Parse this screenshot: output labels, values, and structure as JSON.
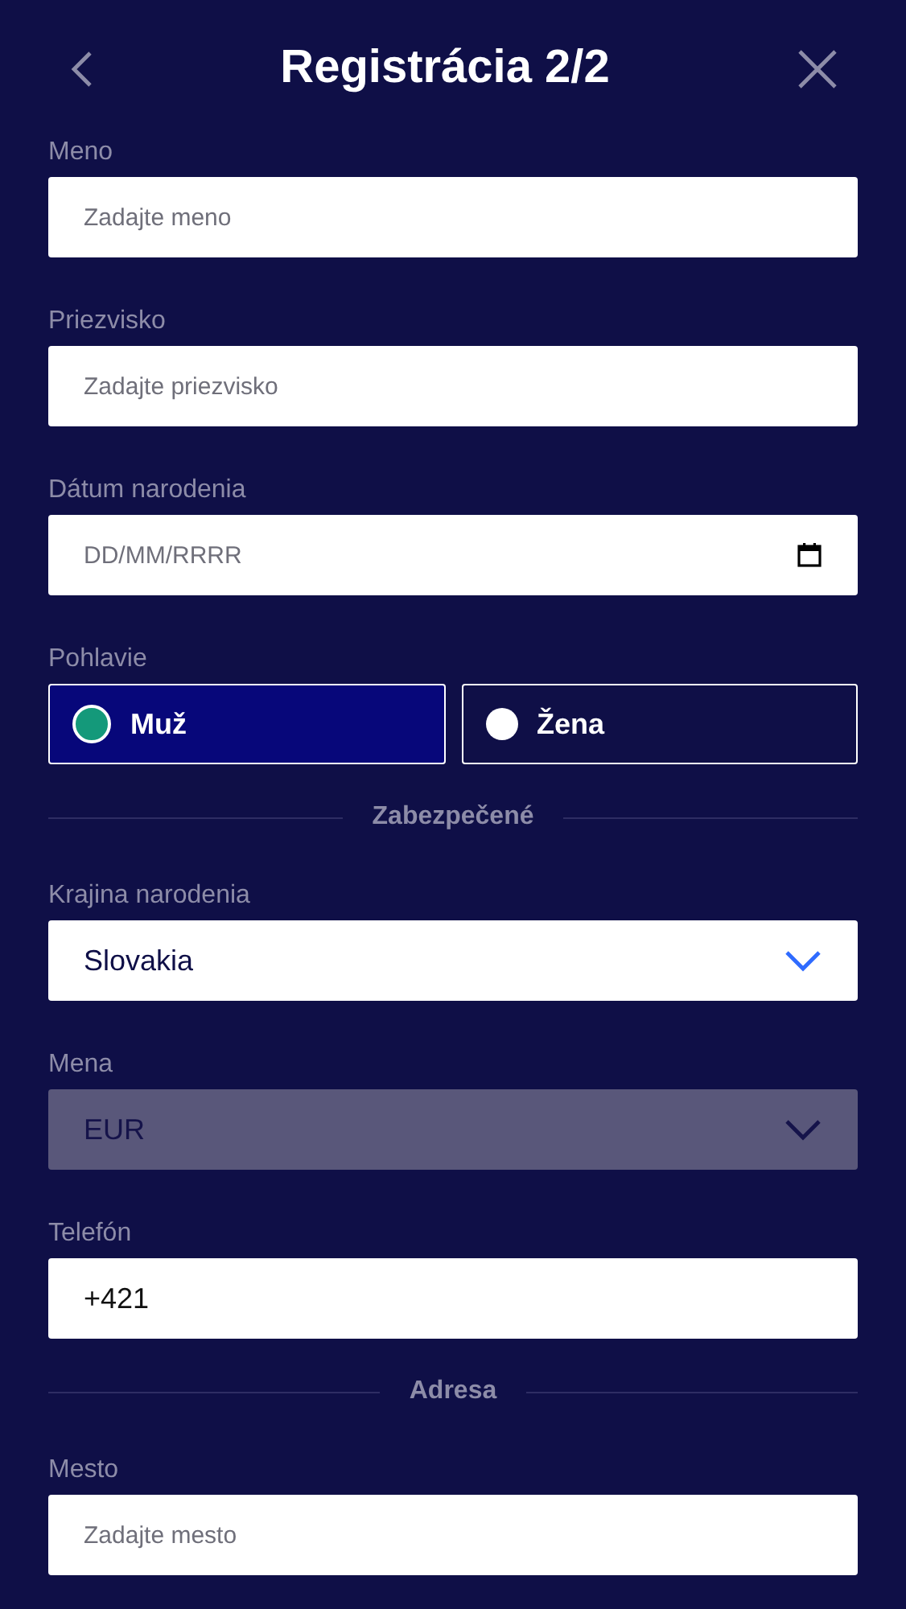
{
  "header": {
    "title": "Registrácia 2/2"
  },
  "items": [
    {
      "kind": "text",
      "label": "Meno",
      "placeholder": "Zadajte meno"
    },
    {
      "kind": "text",
      "label": "Priezvisko",
      "placeholder": "Zadajte priezvisko"
    },
    {
      "kind": "date",
      "label": "Dátum narodenia",
      "placeholder": "DD/MM/RRRR"
    },
    {
      "kind": "radio",
      "label": "Pohlavie",
      "options": [
        {
          "label": "Muž",
          "selected": true
        },
        {
          "label": "Žena",
          "selected": false
        }
      ]
    },
    {
      "kind": "divider",
      "label": "Zabezpečené"
    },
    {
      "kind": "select",
      "label": "Krajina narodenia",
      "value": "Slovakia",
      "disabled": false
    },
    {
      "kind": "select",
      "label": "Mena",
      "value": "EUR",
      "disabled": true
    },
    {
      "kind": "value",
      "label": "Telefón",
      "value": "+421"
    },
    {
      "kind": "divider",
      "label": "Adresa"
    },
    {
      "kind": "text",
      "label": "Mesto",
      "placeholder": "Zadajte mesto"
    }
  ]
}
